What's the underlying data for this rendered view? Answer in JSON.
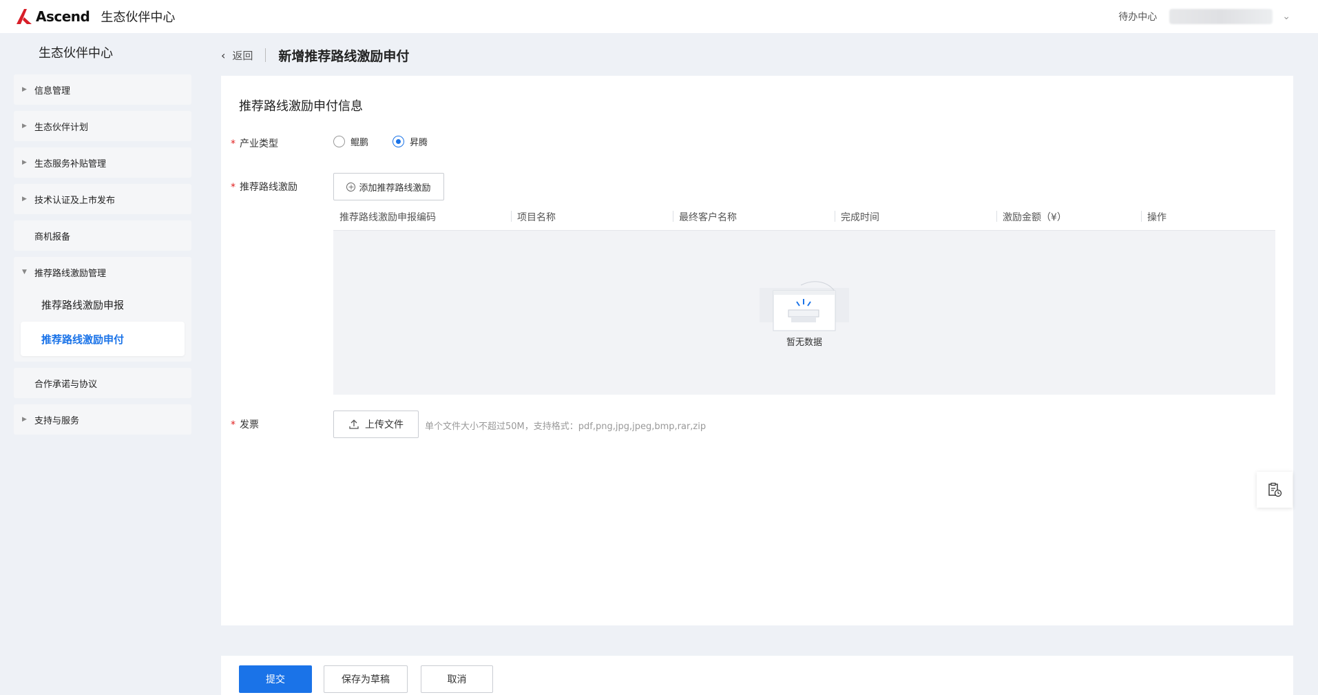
{
  "topbar": {
    "logo_text": "Ascend",
    "brand": "生态伙伴中心",
    "todo": "待办中心",
    "chevron": "⌄"
  },
  "sidebar": {
    "title": "生态伙伴中心",
    "items": [
      {
        "label": "信息管理"
      },
      {
        "label": "生态伙伴计划"
      },
      {
        "label": "生态服务补贴管理"
      },
      {
        "label": "技术认证及上市发布"
      },
      {
        "label": "商机报备"
      },
      {
        "label": "推荐路线激励管理"
      },
      {
        "label": "合作承诺与协议"
      },
      {
        "label": "支持与服务"
      }
    ],
    "sub_items": [
      {
        "label": "推荐路线激励申报"
      },
      {
        "label": "推荐路线激励申付"
      }
    ]
  },
  "header": {
    "back": "返回",
    "title": "新增推荐路线激励申付"
  },
  "form": {
    "section_title": "推荐路线激励申付信息",
    "required_mark": "*",
    "industry_label": "产业类型",
    "industry_options": [
      "鲲鹏",
      "昇腾"
    ],
    "incentive_label": "推荐路线激励",
    "add_button": "添加推荐路线激励",
    "table": {
      "columns": [
        "推荐路线激励申报编码",
        "项目名称",
        "最终客户名称",
        "完成时间",
        "激励金额（¥）",
        "操作"
      ],
      "empty_text": "暂无数据"
    },
    "invoice_label": "发票",
    "upload_button": "上传文件",
    "upload_hint": "单个文件大小不超过50M，支持格式：pdf,png,jpg,jpeg,bmp,rar,zip"
  },
  "actions": {
    "submit": "提交",
    "save_draft": "保存为草稿",
    "cancel": "取消"
  },
  "colors": {
    "primary": "#1a73e8",
    "required": "#e02020",
    "logo_red": "#d81e28"
  }
}
